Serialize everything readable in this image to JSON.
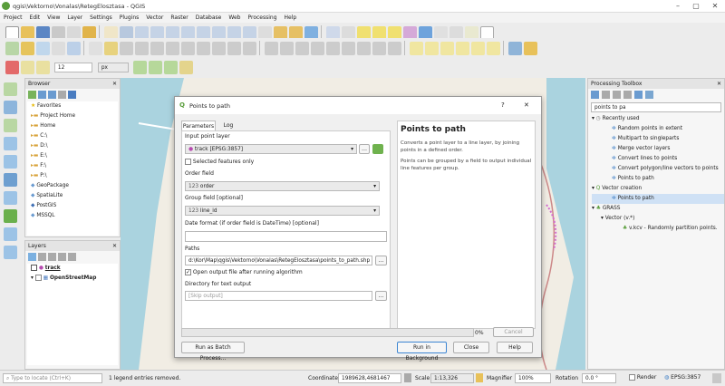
{
  "window": {
    "title": "qgis\\Vektorno\\Vonalas\\RetegElosztasa - QGIS",
    "min": "–",
    "max": "▢",
    "close": "✕"
  },
  "menu": [
    "Project",
    "Edit",
    "View",
    "Layer",
    "Settings",
    "Plugins",
    "Vector",
    "Raster",
    "Database",
    "Web",
    "Processing",
    "Help"
  ],
  "snapping": {
    "tolerance": "12",
    "units": "px"
  },
  "browser": {
    "title": "Browser",
    "items": [
      "Favorites",
      "Project Home",
      "Home",
      "C:\\",
      "D:\\",
      "E:\\",
      "F:\\",
      "P:\\",
      "GeoPackage",
      "SpatiaLite",
      "PostGIS",
      "MSSQL"
    ]
  },
  "layers": {
    "title": "Layers",
    "items": [
      "track",
      "OpenStreetMap"
    ]
  },
  "toolbox": {
    "title": "Processing Toolbox",
    "search": "points to pa",
    "tree": [
      "Recently used",
      "Random points in extent",
      "Multipart to singleparts",
      "Merge vector layers",
      "Convert lines to points",
      "Convert polygon/line vectors to points",
      "Points to path",
      "Vector creation",
      "Points to path",
      "GRASS",
      "Vector (v.*)",
      "v.kcv - Randomly partition points."
    ]
  },
  "dialog": {
    "title": "Points to path",
    "help": "?",
    "close": "✕",
    "tabs": [
      "Parameters",
      "Log"
    ],
    "input_label": "Input point layer",
    "input_value": "track [EPSG:3857]",
    "selected_only": "Selected features only",
    "order_label": "Order field",
    "order_value": "order",
    "group_label": "Group field [optional]",
    "group_value": "line_id",
    "date_label": "Date format (if order field is DateTime) [optional]",
    "date_value": "",
    "paths_label": "Paths",
    "paths_value": "d:\\Kor\\Map\\qgis\\Vektorno\\Vonalas\\RetegElosztasa\\points_to_path.shp",
    "open_output": "Open output file after running algorithm",
    "dir_label": "Directory for text output",
    "dir_placeholder": "[Skip output]",
    "progress_pct": "0%",
    "progress_value": 0,
    "cancel": "Cancel",
    "batch": "Run as Batch Process...",
    "run_bg": "Run in Background",
    "close_btn": "Close",
    "help_btn": "Help",
    "help_title": "Points to path",
    "help_text1": "Converts a point layer to a line layer, by joining points in a defined order.",
    "help_text2": "Points can be grouped by a field to output individual line features per group."
  },
  "status": {
    "locate": "Type to locate (Ctrl+K)",
    "message": "1 legend entries removed.",
    "coord_label": "Coordinate",
    "coord": "1989628,4681467",
    "scale_label": "Scale",
    "scale": "1:13,326",
    "magnifier_label": "Magnifier",
    "magnifier": "100%",
    "rotation_label": "Rotation",
    "rotation": "0.0 °",
    "render": "Render",
    "crs": "EPSG:3857"
  }
}
